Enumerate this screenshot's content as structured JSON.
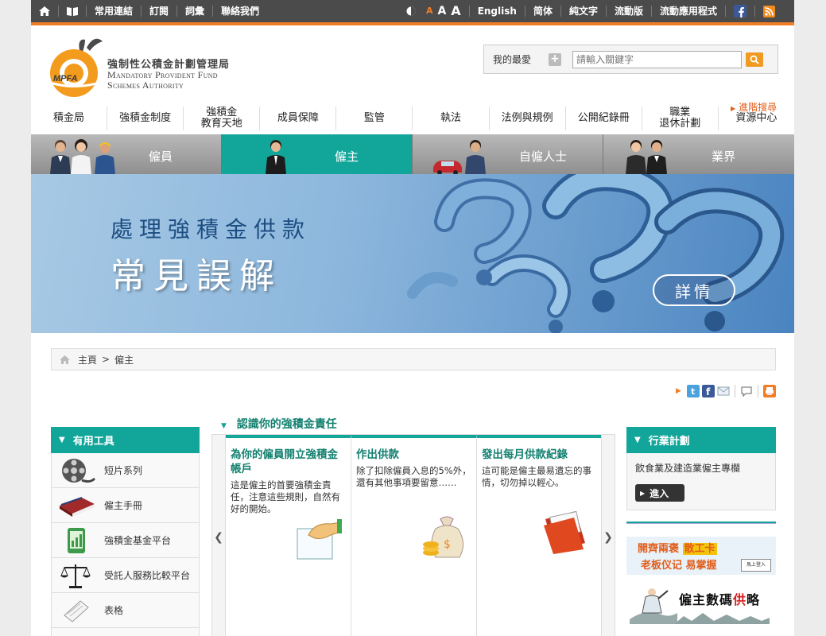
{
  "topbar": {
    "links": [
      "常用連結",
      "訂閱",
      "詞彙",
      "聯絡我們"
    ],
    "font_sizes": [
      "A",
      "A",
      "A"
    ],
    "right_links": [
      "English",
      "简体",
      "純文字",
      "流動版",
      "流動應用程式"
    ]
  },
  "header": {
    "logo_cn": "強制性公積金計劃管理局",
    "logo_en_line1": "Mandatory Provident Fund",
    "logo_en_line2": "Schemes Authority",
    "logo_mark": "MPFA",
    "favorites_label": "我的最愛",
    "search_placeholder": "請輸入關鍵字",
    "advanced_search": "進階搜尋"
  },
  "mainnav": [
    {
      "label": "積金局"
    },
    {
      "label": "強積金制度"
    },
    {
      "label": "強積金\n教育天地"
    },
    {
      "label": "成員保障"
    },
    {
      "label": "監管"
    },
    {
      "label": "執法"
    },
    {
      "label": "法例與規例"
    },
    {
      "label": "公開紀錄冊"
    },
    {
      "label": "職業\n退休計劃"
    },
    {
      "label": "資源中心"
    }
  ],
  "audience_tabs": [
    "僱員",
    "僱主",
    "自僱人士",
    "業界"
  ],
  "banner": {
    "line1": "處理強積金供款",
    "line2": "常見誤解",
    "button": "詳情"
  },
  "breadcrumb": {
    "home": "主頁",
    "separator": ">",
    "current": "僱主"
  },
  "left_box": {
    "title": "有用工具",
    "items": [
      "短片系列",
      "僱主手冊",
      "強積金基金平台",
      "受託人服務比較平台",
      "表格"
    ]
  },
  "center": {
    "title": "認識你的強積金責任",
    "cards": [
      {
        "title": "為你的僱員開立強積金帳戶",
        "text": "這是僱主的首要強積金責任，注意這些規則，自然有好的開始。"
      },
      {
        "title": "作出供款",
        "text": "除了扣除僱員入息的5%外，還有其他事項要留意……"
      },
      {
        "title": "發出每月供款紀錄",
        "text": "這可能是僱主最易遺忘的事情，切勿掉以輕心。"
      }
    ]
  },
  "right_box": {
    "title": "行業計劃",
    "text": "飲食業及建造業僱主專欄",
    "button": "進入",
    "promo1_line1a": "開齊兩褒",
    "promo1_line1b": "散工卡",
    "promo1_line2": "老板仪记 易掌握",
    "promo1_card": "馬上登入",
    "promo2_a": "僱主數碼",
    "promo2_b": "供",
    "promo2_c": "略"
  },
  "colors": {
    "teal": "#12a69b",
    "orange": "#f07e26",
    "topbar": "#4b4b4b"
  }
}
